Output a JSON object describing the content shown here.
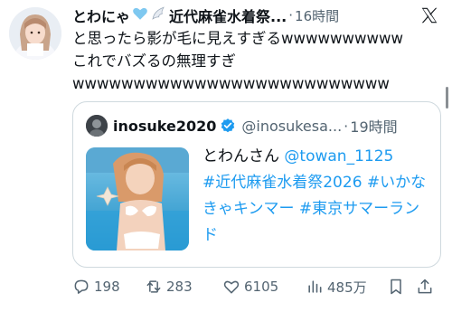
{
  "post": {
    "author_name": "とわにゃ",
    "author_name_suffix": "近代麻雀水着祭...",
    "separator": "·",
    "time": "16時間",
    "text_lines": "と思ったら影が毛に見えすぎるwwwwwwwwww\nこれでバズるの無理すぎ",
    "text_tail": "wwwwwwwwwwwwwwwwwwwwwwwwww"
  },
  "quote": {
    "author_name": "inosuke2020",
    "handle": "@inosukesa...",
    "separator": "·",
    "time": "19時間",
    "line1_text": "とわんさん ",
    "line1_mention": "@towan_1125",
    "hashtags": "#近代麻雀水着祭2026 #いかなきゃキンマー #東京サマーランド"
  },
  "actions": {
    "replies": "198",
    "reposts": "283",
    "likes": "6105",
    "views": "485万"
  },
  "icons": {
    "reply": "reply-icon",
    "repost": "repost-icon",
    "like": "heart-icon",
    "views": "views-icon",
    "bookmark": "bookmark-icon",
    "share": "share-icon",
    "platform": "x-logo-icon",
    "verified": "verified-badge-icon"
  },
  "colors": {
    "accent": "#1d9bf0",
    "text": "#0f1419",
    "muted": "#536471",
    "border": "#cfd9de"
  }
}
